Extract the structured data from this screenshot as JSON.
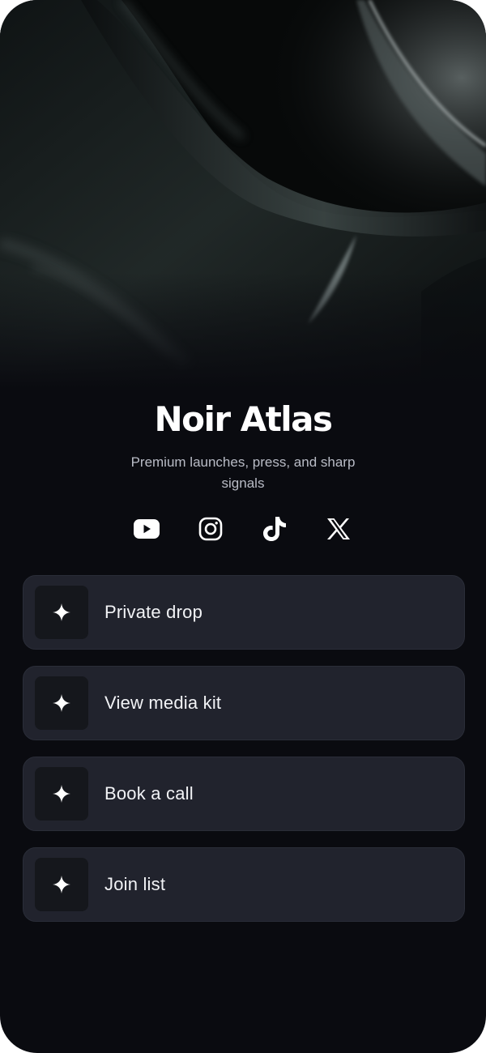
{
  "profile": {
    "name": "Noir Atlas",
    "tagline": "Premium launches, press, and sharp signals"
  },
  "hero": {
    "description_icon": "abstract-dark-silk-cover-image"
  },
  "socials": [
    {
      "icon": "youtube-icon"
    },
    {
      "icon": "instagram-icon"
    },
    {
      "icon": "tiktok-icon"
    },
    {
      "icon": "x-icon"
    }
  ],
  "links": [
    {
      "label": "Private drop",
      "icon": "sparkle-icon"
    },
    {
      "label": "View media kit",
      "icon": "sparkle-icon"
    },
    {
      "label": "Book a call",
      "icon": "sparkle-icon"
    },
    {
      "label": "Join list",
      "icon": "sparkle-icon"
    }
  ],
  "colors": {
    "background": "#0a0b10",
    "card": "#21232d",
    "icon_box": "#15171c",
    "text": "#ffffff",
    "muted_text": "#b9bcc6"
  }
}
